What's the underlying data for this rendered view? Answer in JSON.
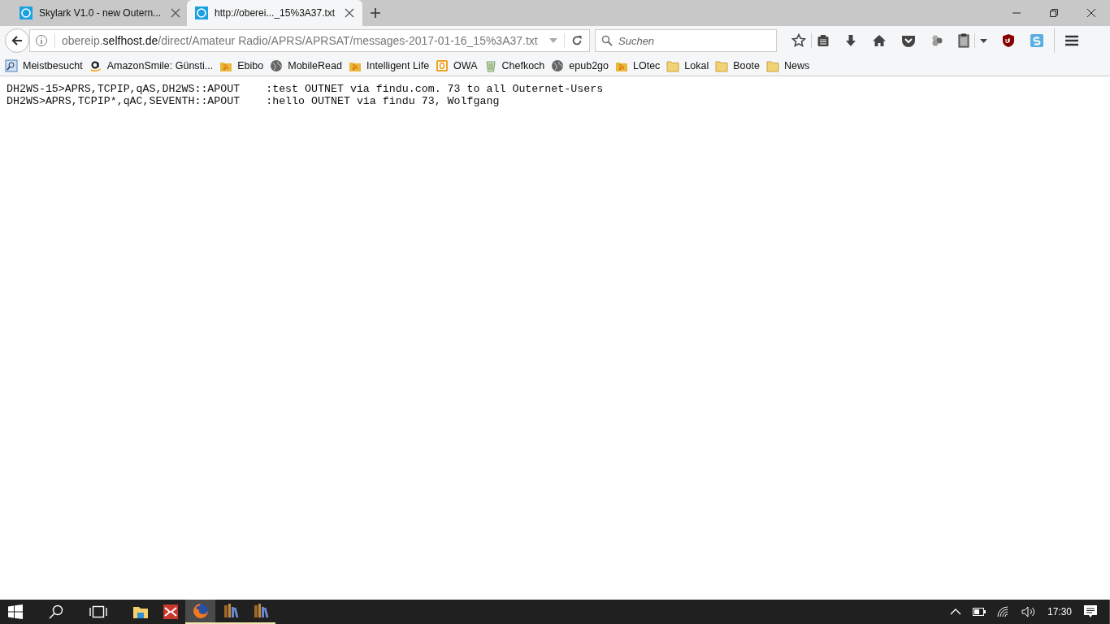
{
  "tabs": [
    {
      "title": "Skylark V1.0 - new Outern...",
      "selected": false
    },
    {
      "title": "http://oberei..._15%3A37.txt",
      "selected": true
    }
  ],
  "address_bar": {
    "host_prefix": "obereip.",
    "domain": "selfhost.de",
    "path": "/direct/Amateur Radio/APRS/APRSAT/messages-2017-01-16_15%3A37.txt"
  },
  "search": {
    "placeholder": "Suchen"
  },
  "bookmarks": [
    {
      "label": "Meistbesucht",
      "kind": "smart"
    },
    {
      "label": "AmazonSmile: Günsti...",
      "kind": "amazon"
    },
    {
      "label": "Ebibo",
      "kind": "feed"
    },
    {
      "label": "MobileRead",
      "kind": "globe"
    },
    {
      "label": "Intelligent Life",
      "kind": "feed"
    },
    {
      "label": "OWA",
      "kind": "mail"
    },
    {
      "label": "Chefkoch",
      "kind": "bin"
    },
    {
      "label": "epub2go",
      "kind": "globe"
    },
    {
      "label": "LOtec",
      "kind": "feed"
    },
    {
      "label": "Lokal",
      "kind": "folder"
    },
    {
      "label": "Boote",
      "kind": "folder"
    },
    {
      "label": "News",
      "kind": "folder"
    }
  ],
  "content_lines": [
    "DH2WS-15>APRS,TCPIP,qAS,DH2WS::APOUT    :test OUTNET via findu.com. 73 to all Outernet-Users",
    "DH2WS>APRS,TCPIP*,qAC,SEVENTH::APOUT    :hello OUTNET via findu 73, Wolfgang"
  ],
  "taskbar": {
    "apps": [
      {
        "kind": "explorer",
        "running": false,
        "active": false
      },
      {
        "kind": "red",
        "running": false,
        "active": false
      },
      {
        "kind": "firefox",
        "running": true,
        "active": true
      },
      {
        "kind": "books",
        "running": true,
        "active": false
      },
      {
        "kind": "books",
        "running": true,
        "active": false
      }
    ],
    "clock": "17:30"
  }
}
